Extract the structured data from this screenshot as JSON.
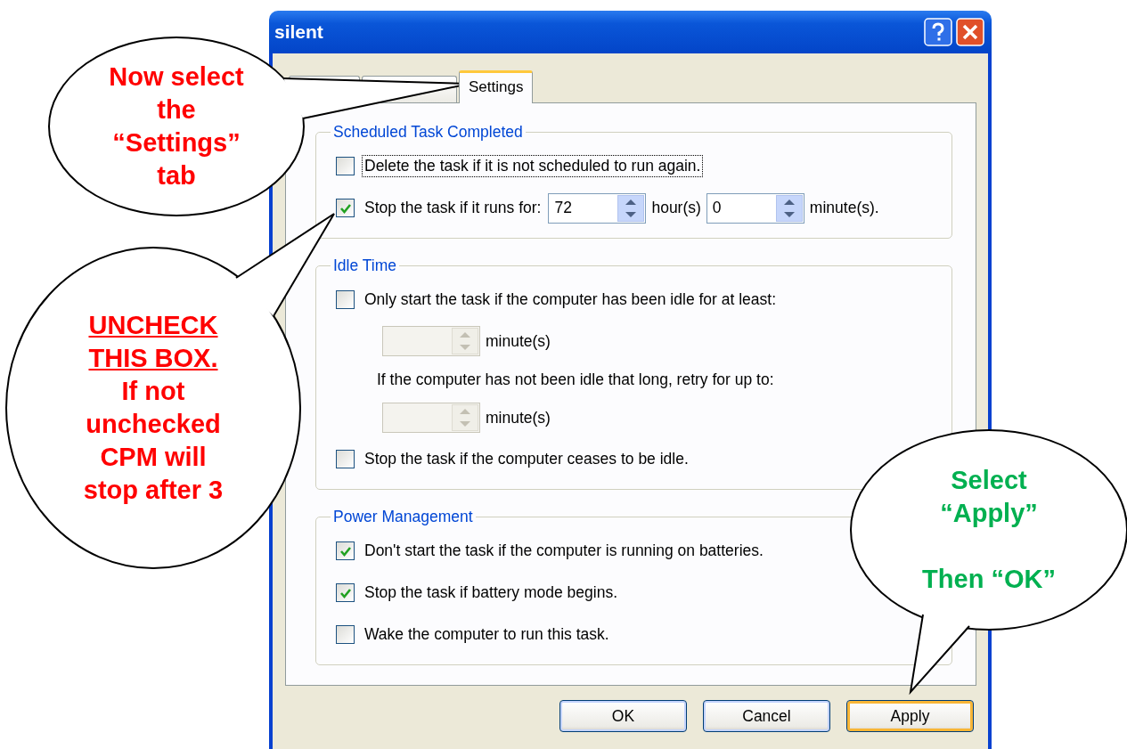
{
  "window": {
    "title": "silent"
  },
  "tabs": [
    {
      "selected": false
    },
    {
      "selected": false
    },
    {
      "label": "Settings",
      "selected": true
    }
  ],
  "groups": [
    {
      "title": "Scheduled Task Completed",
      "items": [
        {
          "kind": "checkbox",
          "label": "Delete the task if it is not scheduled to run again.",
          "checked": false,
          "focused": true
        },
        {
          "kind": "duration",
          "label": "Stop the task if it runs for:",
          "checked": true,
          "fields": [
            {
              "value": "72",
              "unit": "hour(s)"
            },
            {
              "value": "0",
              "unit": "minute(s)."
            }
          ]
        }
      ]
    },
    {
      "title": "Idle Time",
      "items": [
        {
          "kind": "checkbox",
          "label": "Only start the task if the computer has been idle for at least:",
          "checked": false,
          "focused": false
        },
        {
          "kind": "spinner",
          "unit": "minute(s)",
          "disabled": true
        },
        {
          "kind": "note",
          "label": "If the computer has not been idle that long, retry for up to:"
        },
        {
          "kind": "spinner",
          "unit": "minute(s)",
          "disabled": true
        },
        {
          "kind": "checkbox",
          "label": "Stop the task if the computer ceases to be idle.",
          "checked": false,
          "focused": false
        }
      ]
    },
    {
      "title": "Power Management",
      "items": [
        {
          "kind": "checkbox",
          "label": "Don't start the task if the computer is running on batteries.",
          "checked": true,
          "focused": false
        },
        {
          "kind": "checkbox",
          "label": "Stop the task if battery mode begins.",
          "checked": true,
          "focused": false
        },
        {
          "kind": "checkbox",
          "label": "Wake the computer to run this task.",
          "checked": false,
          "focused": false
        }
      ]
    }
  ],
  "buttons": [
    {
      "label": "OK",
      "default": false
    },
    {
      "label": "Cancel",
      "default": false
    },
    {
      "label": "Apply",
      "default": true
    }
  ],
  "callouts": [
    {
      "color": "#ff0000",
      "text": "Now select\nthe\n“Settings”\ntab"
    },
    {
      "color": "#ff0000",
      "heading": "UNCHECK\nTHIS BOX.",
      "text": "If not\nunchecked\nCPM will\nstop after 3"
    },
    {
      "color": "#00b050",
      "text": "Select\n“Apply”\n\nThen “OK”"
    }
  ]
}
